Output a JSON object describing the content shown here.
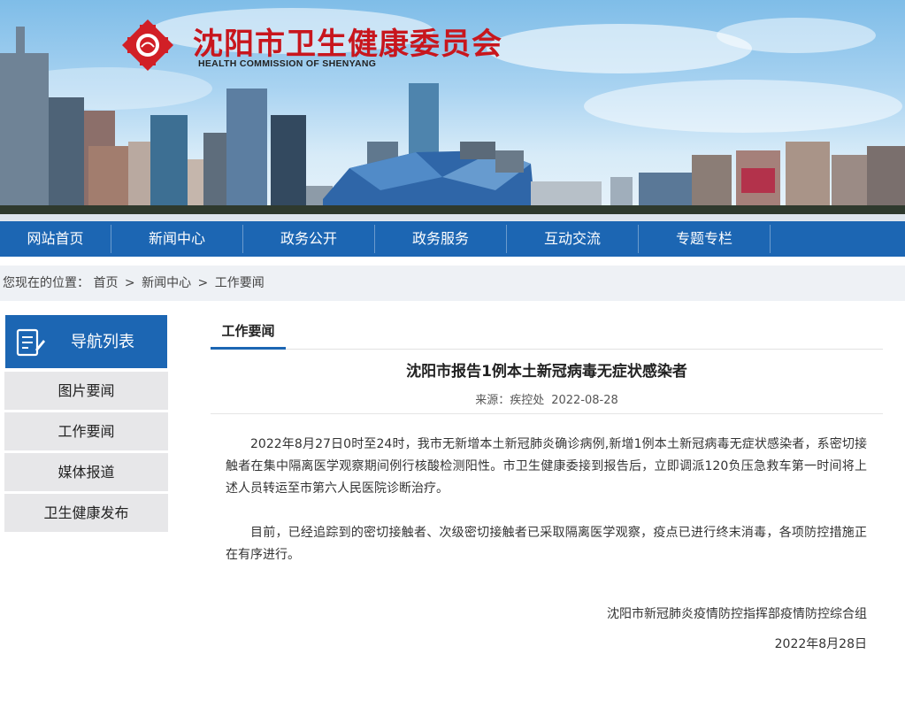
{
  "header": {
    "title": "沈阳市卫生健康委员会",
    "subtitle": "HEALTH COMMISSION OF SHENYANG"
  },
  "nav": {
    "items": [
      "网站首页",
      "新闻中心",
      "政务公开",
      "政务服务",
      "互动交流",
      "专题专栏"
    ]
  },
  "breadcrumb": {
    "prefix": "您现在的位置：",
    "items": [
      "首页",
      "新闻中心",
      "工作要闻"
    ],
    "separator": ">"
  },
  "sidebar": {
    "title": "导航列表",
    "items": [
      "图片要闻",
      "工作要闻",
      "媒体报道",
      "卫生健康发布"
    ]
  },
  "main": {
    "tab": "工作要闻",
    "article": {
      "title": "沈阳市报告1例本土新冠病毒无症状感染者",
      "source_label": "来源：",
      "source": "疾控处",
      "date": "2022-08-28",
      "paragraphs": [
        "2022年8月27日0时至24时，我市无新增本土新冠肺炎确诊病例,新增1例本土新冠病毒无症状感染者，系密切接触者在集中隔离医学观察期间例行核酸检测阳性。市卫生健康委接到报告后，立即调派120负压急救车第一时间将上述人员转运至市第六人民医院诊断治疗。",
        "目前，已经追踪到的密切接触者、次级密切接触者已采取隔离医学观察，疫点已进行终末消毒，各项防控措施正在有序进行。"
      ],
      "signature_org": "沈阳市新冠肺炎疫情防控指挥部疫情防控综合组",
      "signature_date": "2022年8月28日"
    }
  },
  "colors": {
    "brand_blue": "#1c66b3",
    "brand_red": "#c8161d"
  },
  "icons": {
    "logo": "red-cross-emblem",
    "sidebar": "document-list-icon"
  }
}
